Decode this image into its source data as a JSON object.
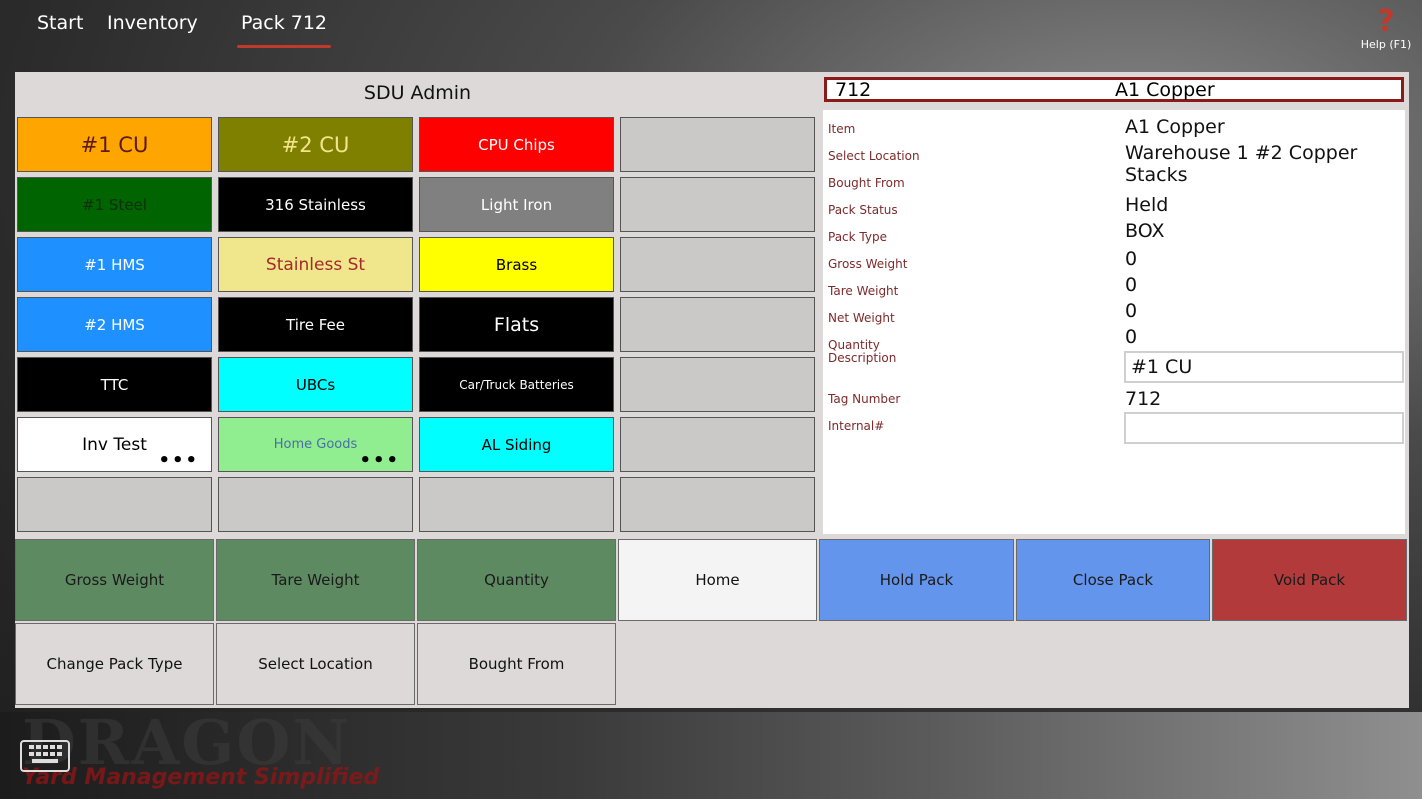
{
  "nav": {
    "items": [
      "Start",
      "Inventory",
      "Pack 712"
    ],
    "active_index": 2
  },
  "help": {
    "label": "Help (F1)",
    "icon": "question-mark-icon"
  },
  "panel": {
    "title": "SDU Admin"
  },
  "header": {
    "tag": "712",
    "name": "A1 Copper"
  },
  "tiles": [
    {
      "label": "#1 CU",
      "bg": "#FFA500",
      "fg": "#5c1a1a",
      "size": 21
    },
    {
      "label": "#2 CU",
      "bg": "#808000",
      "fg": "#f3e58a",
      "size": 21
    },
    {
      "label": "CPU Chips",
      "bg": "#FF0000",
      "fg": "#ffffff",
      "size": 15
    },
    {
      "label": "",
      "bg": "#cbc8c8",
      "fg": "#000",
      "size": 15
    },
    {
      "label": "#1 Steel",
      "bg": "#006400",
      "fg": "#0f2e0f",
      "size": 15
    },
    {
      "label": "316 Stainless",
      "bg": "#000000",
      "fg": "#ffffff",
      "size": 15
    },
    {
      "label": "Light Iron",
      "bg": "#808080",
      "fg": "#ffffff",
      "size": 15
    },
    {
      "label": "",
      "bg": "#cbc8c8",
      "fg": "#000",
      "size": 15
    },
    {
      "label": "#1 HMS",
      "bg": "#1E90FF",
      "fg": "#ffffff",
      "size": 15
    },
    {
      "label": "Stainless St",
      "bg": "#F0E68C",
      "fg": "#a52a2a",
      "size": 17
    },
    {
      "label": "Brass",
      "bg": "#FFFF00",
      "fg": "#000000",
      "size": 15
    },
    {
      "label": "",
      "bg": "#cbc8c8",
      "fg": "#000",
      "size": 15
    },
    {
      "label": "#2 HMS",
      "bg": "#1E90FF",
      "fg": "#ffffff",
      "size": 15
    },
    {
      "label": "Tire Fee",
      "bg": "#000000",
      "fg": "#ffffff",
      "size": 15
    },
    {
      "label": "Flats",
      "bg": "#000000",
      "fg": "#ffffff",
      "size": 19
    },
    {
      "label": "",
      "bg": "#cbc8c8",
      "fg": "#000",
      "size": 15
    },
    {
      "label": "TTC",
      "bg": "#000000",
      "fg": "#ffffff",
      "size": 15
    },
    {
      "label": "UBCs",
      "bg": "#00FFFF",
      "fg": "#000000",
      "size": 15
    },
    {
      "label": "Car/Truck Batteries",
      "bg": "#000000",
      "fg": "#ffffff",
      "size": 12
    },
    {
      "label": "",
      "bg": "#cbc8c8",
      "fg": "#000",
      "size": 15
    },
    {
      "label": "Inv Test",
      "bg": "#ffffff",
      "fg": "#000000",
      "size": 17,
      "more": "•••"
    },
    {
      "label": "Home Goods",
      "bg": "#90EE90",
      "fg": "#4a6fa5",
      "size": 13,
      "more": "•••"
    },
    {
      "label": "AL Siding",
      "bg": "#00FFFF",
      "fg": "#000000",
      "size": 15
    },
    {
      "label": "",
      "bg": "#cbc8c8",
      "fg": "#000",
      "size": 15
    },
    {
      "label": "",
      "bg": "#cbc8c8",
      "fg": "#000",
      "size": 15
    },
    {
      "label": "",
      "bg": "#cbc8c8",
      "fg": "#000",
      "size": 15
    },
    {
      "label": "",
      "bg": "#cbc8c8",
      "fg": "#000",
      "size": 15
    },
    {
      "label": "",
      "bg": "#cbc8c8",
      "fg": "#000",
      "size": 15
    }
  ],
  "details": [
    {
      "label": "Item",
      "value": "A1 Copper"
    },
    {
      "label": "Select Location",
      "value": "Warehouse 1 #2 Copper Stacks"
    },
    {
      "label": "Bought From",
      "value": ""
    },
    {
      "label": "Pack Status",
      "value": "Held"
    },
    {
      "label": "Pack Type",
      "value": "BOX"
    },
    {
      "label": "Gross Weight",
      "value": "0"
    },
    {
      "label": "Tare Weight",
      "value": "0"
    },
    {
      "label": "Net Weight",
      "value": "0"
    },
    {
      "label": "Quantity",
      "value": "0"
    }
  ],
  "description": {
    "label": "Description",
    "value": "#1 CU"
  },
  "tag_number": {
    "label": "Tag Number",
    "value": "712"
  },
  "internal": {
    "label": "Internal#",
    "value": ""
  },
  "buttons_row1": [
    {
      "label": "Gross Weight",
      "bg": "#5e8a62",
      "fg": "#1a1a1a"
    },
    {
      "label": "Tare Weight",
      "bg": "#5e8a62",
      "fg": "#1a1a1a"
    },
    {
      "label": "Quantity",
      "bg": "#5e8a62",
      "fg": "#1a1a1a"
    },
    {
      "label": "Home",
      "bg": "#f4f4f4",
      "fg": "#111111"
    },
    {
      "label": "Hold Pack",
      "bg": "#6495ED",
      "fg": "#1a1a1a"
    },
    {
      "label": "Close Pack",
      "bg": "#6495ED",
      "fg": "#1a1a1a"
    },
    {
      "label": "Void Pack",
      "bg": "#b33a3a",
      "fg": "#1a1a1a"
    }
  ],
  "buttons_row2": [
    {
      "label": "Change Pack Type"
    },
    {
      "label": "Select Location"
    },
    {
      "label": "Bought From"
    }
  ],
  "footer": {
    "logo": "DRAGON",
    "tagline": "Yard Management Simplified",
    "keyboard_icon": "keyboard-icon"
  }
}
